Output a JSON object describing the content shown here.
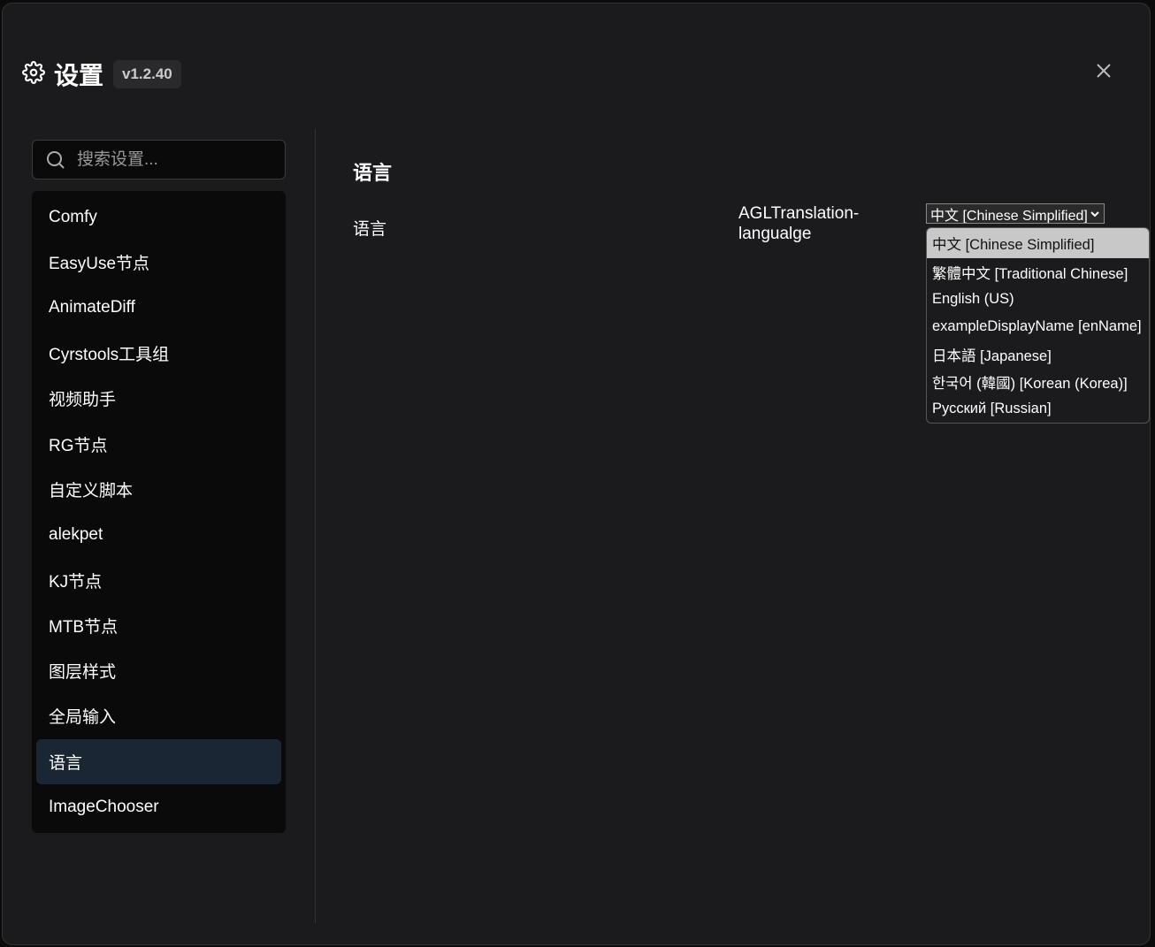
{
  "header": {
    "title": "设置",
    "version": "v1.2.40"
  },
  "search": {
    "placeholder": "搜索设置..."
  },
  "nav": {
    "items": [
      "Comfy",
      "EasyUse节点",
      "AnimateDiff",
      "Cyrstools工具组",
      "视频助手",
      "RG节点",
      "自定义脚本",
      "alekpet",
      "KJ节点",
      "MTB节点",
      "图层样式",
      "全局输入",
      "语言",
      "ImageChooser"
    ],
    "active": 12
  },
  "section": {
    "title": "语言",
    "row_label": "语言",
    "setting_id": "AGLTranslation-langualge",
    "selected": "中文 [Chinese Simplified]"
  },
  "options": [
    "中文 [Chinese Simplified]",
    "繁體中文 [Traditional Chinese]",
    "English (US)",
    "exampleDisplayName [enName]",
    "日本語 [Japanese]",
    "한국어 (韓國) [Korean (Korea)]",
    "Русский [Russian]"
  ]
}
